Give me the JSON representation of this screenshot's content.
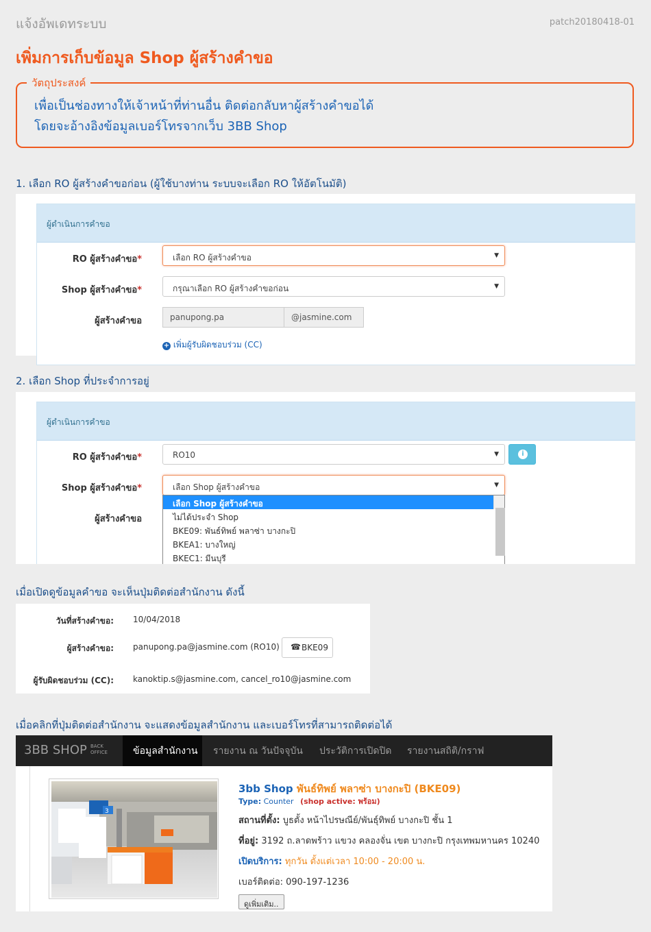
{
  "header": {
    "top_label": "แจ้งอัพเดทระบบ",
    "patch": "patch20180418-01",
    "title": "เพิ่มการเก็บข้อมูล Shop ผู้สร้างคำขอ"
  },
  "objective": {
    "legend": "วัตถุประสงค์",
    "line1": "เพื่อเป็นช่องทางให้เจ้าหน้าที่ท่านอื่น ติดต่อกลับหาผู้สร้างคำขอได้",
    "line2": "โดยจะอ้างอิงข้อมูลเบอร์โทรจากเว็บ 3BB Shop"
  },
  "step1": {
    "title": "1. เลือก RO ผู้สร้างคำขอก่อน (ผู้ใช้บางท่าน ระบบจะเลือก RO ให้อัตโนมัติ)",
    "panel_head": "ผู้ดำเนินการคำขอ",
    "ro_label": "RO ผู้สร้างคำขอ",
    "ro_value": "เลือก RO ผู้สร้างคำขอ",
    "shop_label": "Shop ผู้สร้างคำขอ",
    "shop_value": "กรุณาเลือก RO ผู้สร้างคำขอก่อน",
    "creator_label": "ผู้สร้างคำขอ",
    "creator_user": "panupong.pa",
    "creator_domain": "@jasmine.com",
    "add_cc": "เพิ่มผู้รับผิดชอบร่วม (CC)",
    "required_mark": "*"
  },
  "step2": {
    "title": "2. เลือก Shop ที่ประจำการอยู่",
    "panel_head": "ผู้ดำเนินการคำขอ",
    "ro_label": "RO ผู้สร้างคำขอ",
    "ro_value": "RO10",
    "shop_label": "Shop ผู้สร้างคำขอ",
    "shop_value": "เลือก Shop ผู้สร้างคำขอ",
    "creator_label": "ผู้สร้างคำขอ",
    "options": [
      "เลือก Shop ผู้สร้างคำขอ",
      "ไม่ได้ประจำ Shop",
      "BKE09: พันธ์ทิพย์ พลาซ่า บางกะปิ",
      "BKEA1: บางใหญ่",
      "BKEC1: มีนบุรี"
    ]
  },
  "step3": {
    "title": "เมื่อเปิดดูข้อมูลคำขอ จะเห็นปุ่มติดต่อสำนักงาน ดังนี้",
    "created_label": "วันที่สร้างคำขอ:",
    "created_value": "10/04/2018",
    "creator_label": "ผู้สร้างคำขอ:",
    "creator_value": "panupong.pa@jasmine.com (RO10)",
    "call_button": "BKE09",
    "cc_label": "ผู้รับผิดชอบร่วม (CC):",
    "cc_value": "kanoktip.s@jasmine.com, cancel_ro10@jasmine.com"
  },
  "step4": {
    "title": "เมื่อคลิกที่ปุ่มติดต่อสำนักงาน จะแสดงข้อมูลสำนักงาน และเบอร์โทรที่สามารถติดต่อได้",
    "brand": "3BB SHOP",
    "brand_sub1": "BACK",
    "brand_sub2": "OFFICE",
    "nav": [
      "ข้อมูลสำนักงาน",
      "รายงาน ณ วันปัจจุบัน",
      "ประวัติการเปิดปิด",
      "รายงานสถิติ/กราฟ"
    ],
    "shop_prefix": "3bb Shop",
    "shop_name": "พันธ์ทิพย์ พลาซ่า บางกะปิ (BKE09)",
    "type_label": "Type:",
    "type_value": "Counter",
    "active_text": "(shop active: พร้อม)",
    "location_label": "สถานที่ตั้ง:",
    "location_value": "บูธตั้ง หน้าไปรษณีย์/พันธุ์ทิพย์ บางกะปิ ชั้น 1",
    "address_label": "ที่อยู่:",
    "address_value": "3192 ถ.ลาดพร้าว แขวง คลองจั่น เขต บางกะปิ กรุงเทพมหานคร 10240",
    "hours_label": "เปิดบริการ:",
    "hours_value": "ทุกวัน ตั้งแต่เวลา 10:00 - 20:00 น.",
    "phone_label": "เบอร์ติดต่อ:",
    "phone_value": "090-197-1236",
    "more_button": "ดูเพิ่มเติม..",
    "photo_sign": "3"
  },
  "colors": {
    "accent": "#ef5a1f",
    "blue_text": "#1b63b5",
    "panel_head": "#d5e8f6",
    "info_button": "#5bc0de",
    "highlight": "#1e90ff"
  }
}
